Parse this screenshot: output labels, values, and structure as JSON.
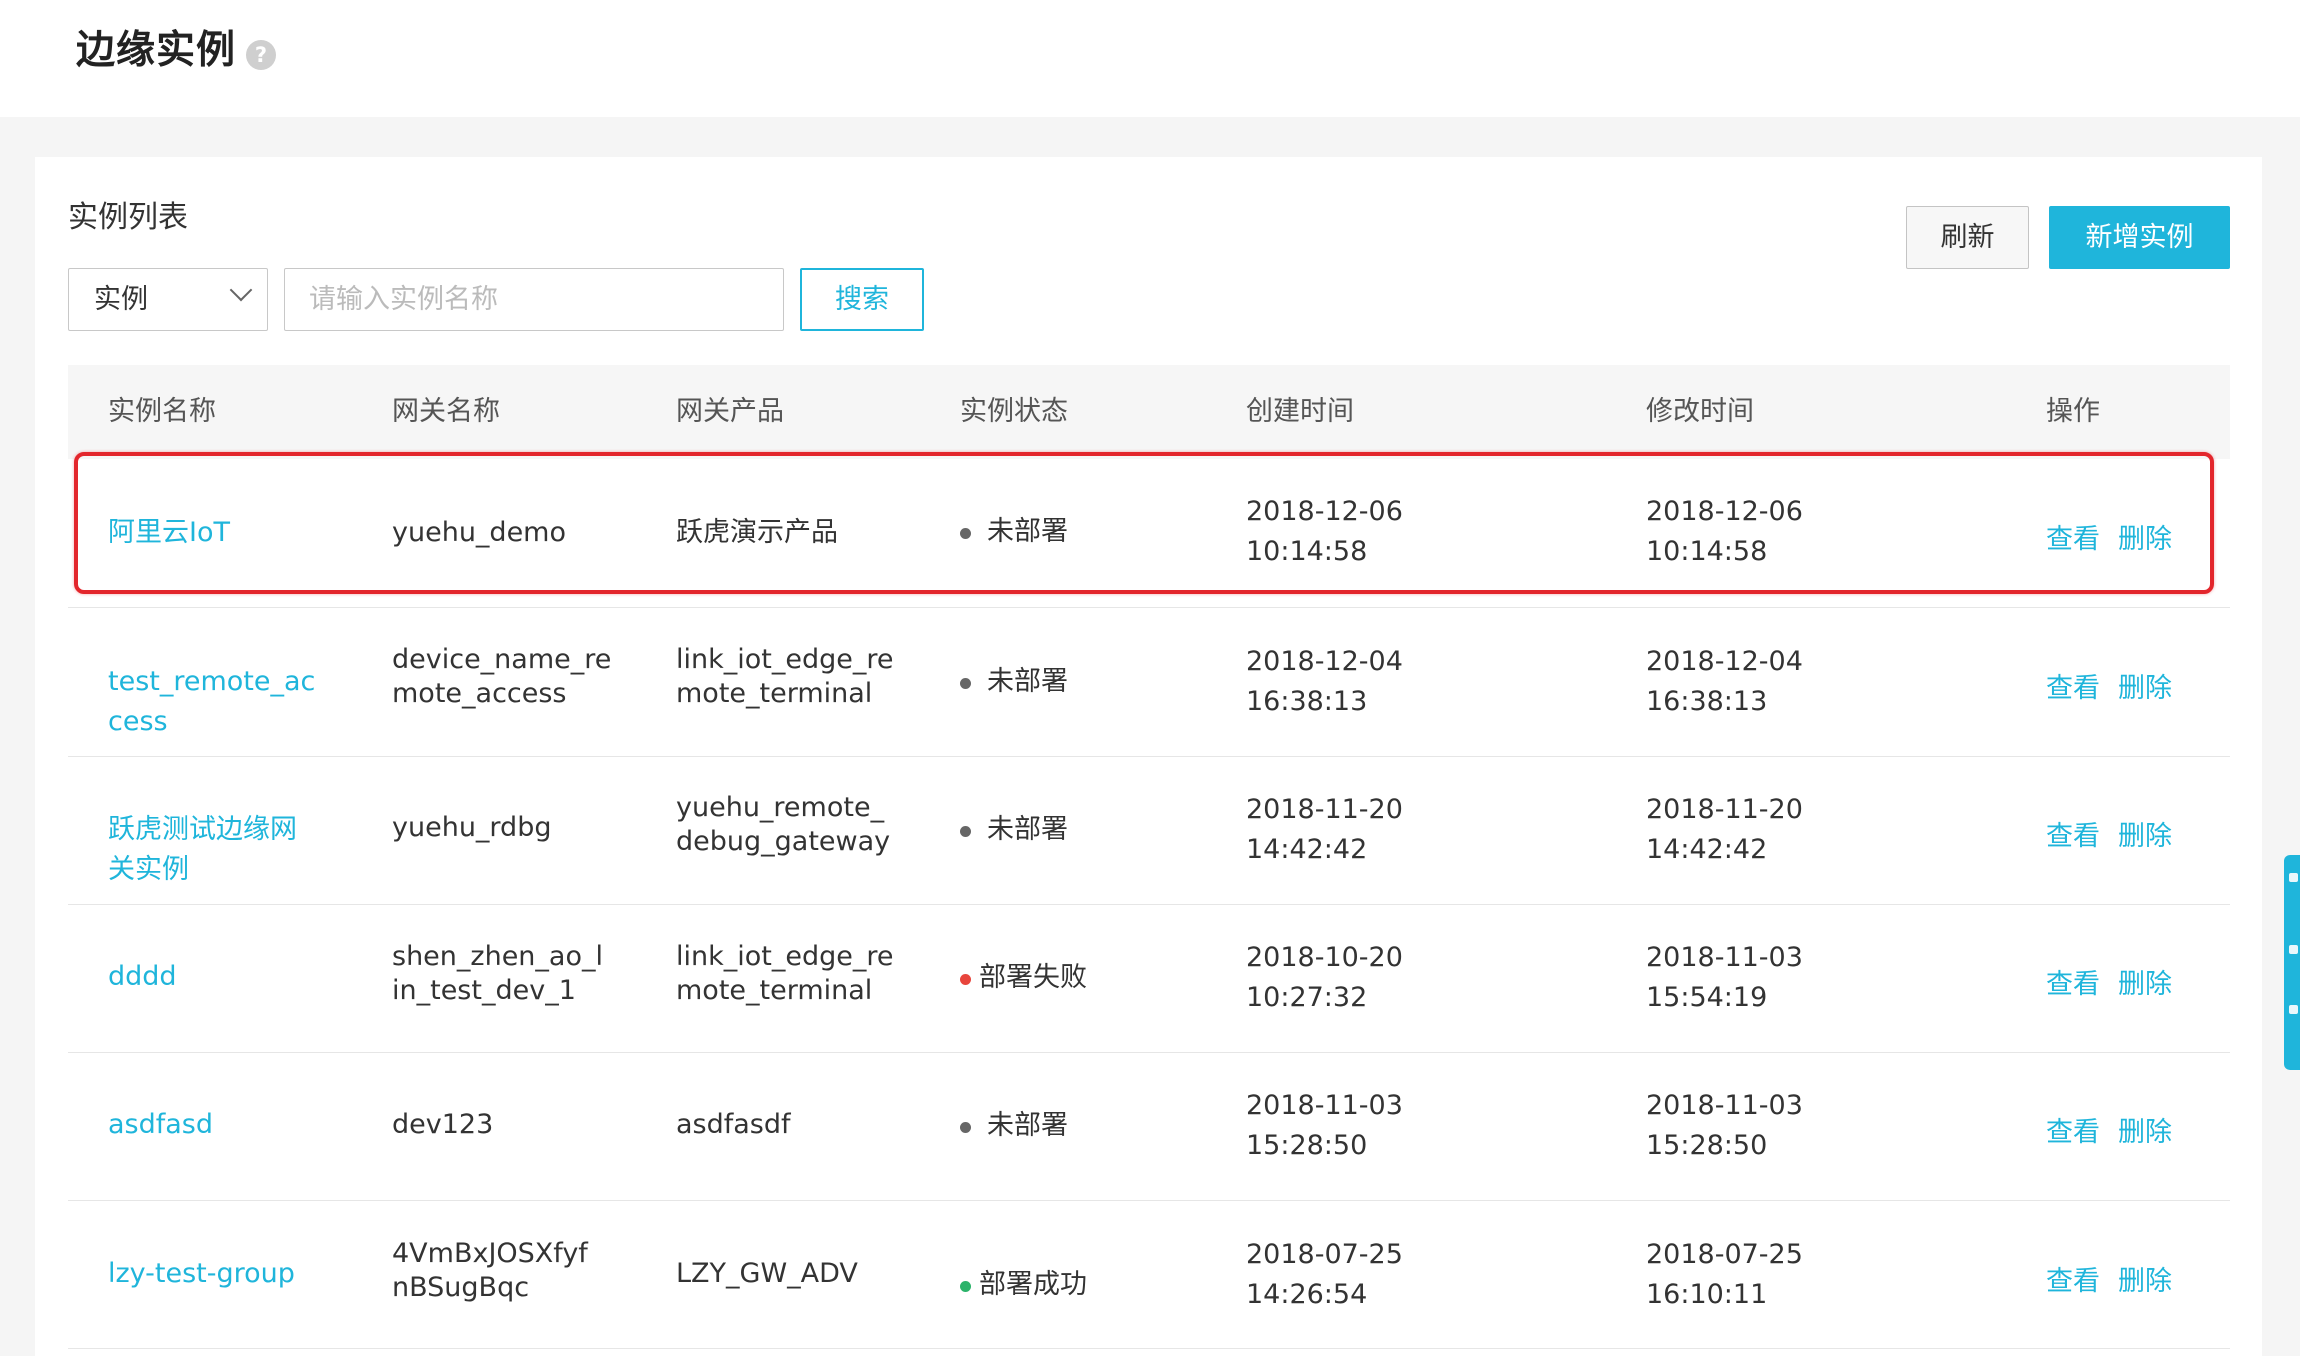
{
  "header": {
    "title": "边缘实例",
    "help_icon": "?"
  },
  "instance_list": {
    "title": "实例列表",
    "refresh_label": "刷新",
    "add_label": "新增实例",
    "filter": {
      "selected": "实例",
      "search_placeholder": "请输入实例名称",
      "search_label": "搜索"
    },
    "columns": [
      "实例名称",
      "网关名称",
      "网关产品",
      "实例状态",
      "创建时间",
      "修改时间",
      "操作"
    ],
    "status_colors": {
      "未部署": "#666666",
      "部署失败": "#e8453c",
      "部署成功": "#2bb36a"
    },
    "rows": [
      {
        "name": "阿里云IoT",
        "gateway_name": "yuehu_demo",
        "gateway_product": "跃虎演示产品",
        "status": "未部署",
        "created_date": "2018-12-06",
        "created_time": "10:14:58",
        "modified_date": "2018-12-06",
        "modified_time": "10:14:58",
        "view_label": "查看",
        "delete_label": "删除"
      },
      {
        "name": "test_remote_ac\ncess",
        "gateway_name": "device_name_re\nmote_access",
        "gateway_product": "link_iot_edge_re\nmote_terminal",
        "status": "未部署",
        "created_date": "2018-12-04",
        "created_time": "16:38:13",
        "modified_date": "2018-12-04",
        "modified_time": "16:38:13",
        "view_label": "查看",
        "delete_label": "删除"
      },
      {
        "name": "跃虎测试边缘网\n关实例",
        "gateway_name": "yuehu_rdbg",
        "gateway_product": "yuehu_remote_\ndebug_gateway",
        "status": "未部署",
        "created_date": "2018-11-20",
        "created_time": "14:42:42",
        "modified_date": "2018-11-20",
        "modified_time": "14:42:42",
        "view_label": "查看",
        "delete_label": "删除"
      },
      {
        "name": "dddd",
        "gateway_name": "shen_zhen_ao_l\nin_test_dev_1",
        "gateway_product": "link_iot_edge_re\nmote_terminal",
        "status": "部署失败",
        "created_date": "2018-10-20",
        "created_time": "10:27:32",
        "modified_date": "2018-11-03",
        "modified_time": "15:54:19",
        "view_label": "查看",
        "delete_label": "删除"
      },
      {
        "name": "asdfasd",
        "gateway_name": "dev123",
        "gateway_product": "asdfasdf",
        "status": "未部署",
        "created_date": "2018-11-03",
        "created_time": "15:28:50",
        "modified_date": "2018-11-03",
        "modified_time": "15:28:50",
        "view_label": "查看",
        "delete_label": "删除"
      },
      {
        "name": "lzy-test-group",
        "gateway_name": "4VmBxJOSXfyf\nnBSugBqc",
        "gateway_product": "LZY_GW_ADV",
        "status": "部署成功",
        "created_date": "2018-07-25",
        "created_time": "14:26:54",
        "modified_date": "2018-07-25",
        "modified_time": "16:10:11",
        "view_label": "查看",
        "delete_label": "删除"
      }
    ]
  },
  "colors": {
    "accent": "#1fb5db",
    "highlight": "#e3262c"
  }
}
